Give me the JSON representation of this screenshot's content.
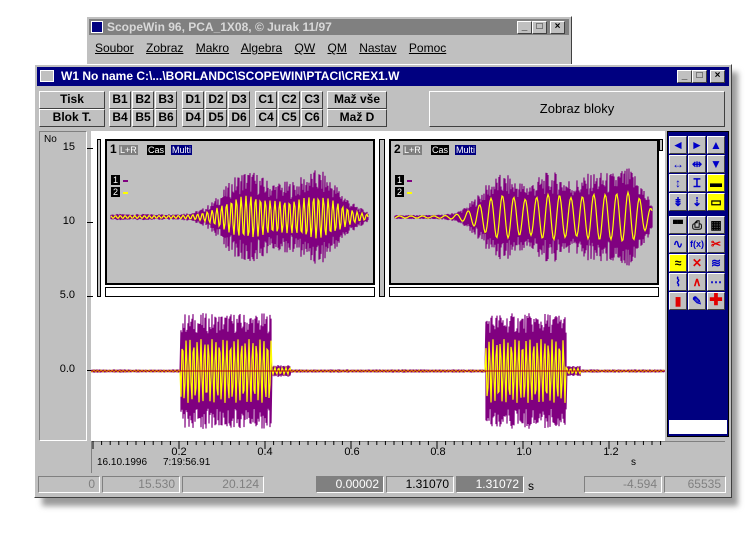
{
  "back_window": {
    "title": "ScopeWin 96, PCA_1X08, © Jurak 11/97",
    "menu": [
      "Soubor",
      "Zobraz",
      "Makro",
      "Algebra",
      "QW",
      "QM",
      "Nastav",
      "Pomoc"
    ]
  },
  "window": {
    "title": "W1 No name C:\\...\\BORLANDC\\SCOPEWIN\\PTACI\\CREX1.W"
  },
  "toolbar": {
    "print": "Tisk",
    "block": "Blok T.",
    "b_row1": [
      "B1",
      "B2",
      "B3"
    ],
    "b_row2": [
      "B4",
      "B5",
      "B6"
    ],
    "d_row1": [
      "D1",
      "D2",
      "D3"
    ],
    "d_row2": [
      "D4",
      "D5",
      "D6"
    ],
    "c_row1": [
      "C1",
      "C2",
      "C3"
    ],
    "c_row2": [
      "C4",
      "C5",
      "C6"
    ],
    "clear_all": "Maž vše",
    "clear_d": "Maž D",
    "show_blocks": "Zobraz bloky"
  },
  "panels": [
    {
      "number": "1",
      "tags": [
        "L+R",
        "Cas",
        "Multi"
      ],
      "legend": [
        "1",
        "2"
      ]
    },
    {
      "number": "2",
      "tags": [
        "L+R",
        "Cas",
        "Multi"
      ],
      "legend": [
        "1",
        "2"
      ]
    }
  ],
  "y_axis": {
    "unit": "No",
    "ticks": [
      "15",
      "10",
      "5.0",
      "0.0"
    ]
  },
  "x_axis": {
    "ticks": [
      "0.2",
      "0.4",
      "0.6",
      "0.8",
      "1.0",
      "1.2"
    ],
    "unit": "s"
  },
  "timestamp": {
    "date": "16.10.1996",
    "time": "7:19:56.91"
  },
  "status": {
    "v0": "0",
    "v1": "15.530",
    "v2": "20.124",
    "t0": "0.00002",
    "t1": "1.31070",
    "t2": "1.31072",
    "unit": "s",
    "v3": "-4.594",
    "v4": "65535"
  },
  "tool_icons": [
    "arrow-left-icon",
    "arrow-right-icon",
    "arrow-up-icon",
    "expand-horizontal-icon",
    "compress-horizontal-icon",
    "arrow-down-icon",
    "expand-vertical-icon",
    "compress-vertical-icon",
    "yellow-panel-icon",
    "shrink-icon",
    "down-small-icon",
    "split-panel-icon",
    "display-icon",
    "printer-icon",
    "table-icon",
    "wave-icon",
    "function-icon",
    "cut-icon",
    "yellow-wave-icon",
    "delete-icon",
    "zigzag-icon",
    "trend-icon",
    "peak-icon",
    "noise-icon",
    "bars-icon",
    "chart-edit-icon",
    "add-icon"
  ],
  "colors": {
    "title_bar": "#000080",
    "plot_bg": "#c0c0c0",
    "envelope": "#800080",
    "signal": "#ffff00",
    "toolbox_bg": "#000080"
  }
}
